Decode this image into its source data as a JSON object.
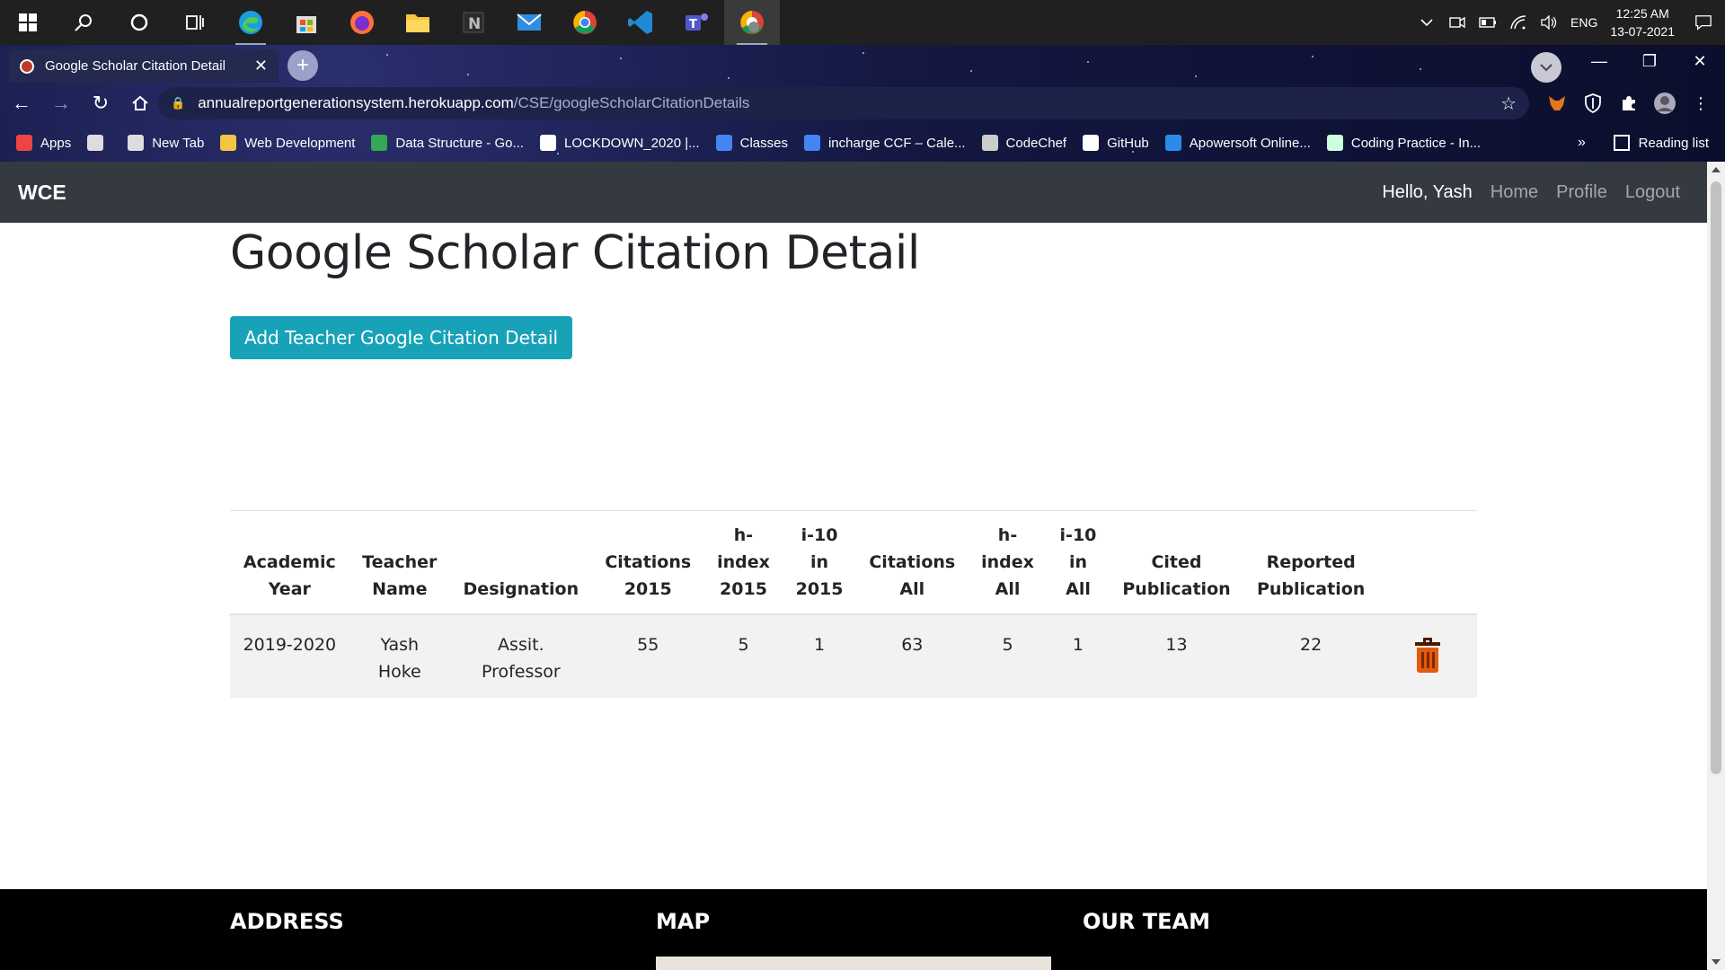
{
  "taskbar": {
    "apps": [
      "windows-start",
      "search",
      "cortana",
      "task-view",
      "edge",
      "store",
      "firefox",
      "file-explorer",
      "notion",
      "mail",
      "chrome",
      "vscode",
      "teams",
      "chrome-profile"
    ],
    "tray": {
      "language": "ENG",
      "time": "12:25 AM",
      "date": "13-07-2021"
    }
  },
  "browser": {
    "tab_title": "Google Scholar Citation Detail",
    "url_host": "annualreportgenerationsystem.herokuapp.com",
    "url_path": "/CSE/googleScholarCitationDetails",
    "bookmarks": [
      {
        "label": "Apps",
        "icon": "apps-grid-icon",
        "color": "#e44"
      },
      {
        "label": "",
        "icon": "globe-icon",
        "color": "#ddd"
      },
      {
        "label": "New Tab",
        "icon": "globe-icon",
        "color": "#ddd"
      },
      {
        "label": "Web Development",
        "icon": "folder-icon",
        "color": "#f6c343"
      },
      {
        "label": "Data Structure - Go...",
        "icon": "drive-icon",
        "color": "#34a853"
      },
      {
        "label": "LOCKDOWN_2020 |...",
        "icon": "trello-icon",
        "color": "#fff"
      },
      {
        "label": "Classes",
        "icon": "classroom-icon",
        "color": "#4285f4"
      },
      {
        "label": "incharge CCF – Cale...",
        "icon": "calendar-icon",
        "color": "#4285f4"
      },
      {
        "label": "CodeChef",
        "icon": "codechef-icon",
        "color": "#ccc"
      },
      {
        "label": "GitHub",
        "icon": "github-icon",
        "color": "#fff"
      },
      {
        "label": "Apowersoft Online...",
        "icon": "apowersoft-icon",
        "color": "#2b8be8"
      },
      {
        "label": "Coding Practice - In...",
        "icon": "mountain-icon",
        "color": "#cfd"
      }
    ],
    "bookmarks_more": "»",
    "reading_list": "Reading list"
  },
  "navbar": {
    "brand": "WCE",
    "greeting": "Hello, Yash",
    "links": [
      "Home",
      "Profile",
      "Logout"
    ]
  },
  "page": {
    "title": "Google Scholar Citation Detail",
    "add_button": "Add Teacher Google Citation Detail"
  },
  "table": {
    "headers": [
      [
        "Academic",
        "Year"
      ],
      [
        "Teacher",
        "Name"
      ],
      [
        "Designation"
      ],
      [
        "Citations",
        "2015"
      ],
      [
        "h-",
        "index",
        "2015"
      ],
      [
        "i-10",
        "in",
        "2015"
      ],
      [
        "Citations",
        "All"
      ],
      [
        "h-",
        "index",
        "All"
      ],
      [
        "i-10",
        "in",
        "All"
      ],
      [
        "Cited",
        "Publication"
      ],
      [
        "Reported",
        "Publication"
      ]
    ],
    "rows": [
      {
        "academic_year": "2019-2020",
        "teacher_name": [
          "Yash",
          "Hoke"
        ],
        "designation": [
          "Assit.",
          "Professor"
        ],
        "citations_2015": "55",
        "h_index_2015": "5",
        "i10_2015": "1",
        "citations_all": "63",
        "h_index_all": "5",
        "i10_all": "1",
        "cited_publication": "13",
        "reported_publication": "22"
      }
    ]
  },
  "footer": {
    "address_heading": "ADDRESS",
    "map_heading": "MAP",
    "team_heading": "OUR TEAM"
  },
  "colors": {
    "navbar_bg": "#343a40",
    "button_bg": "#17a2b8",
    "trash": "#e35b0f"
  }
}
